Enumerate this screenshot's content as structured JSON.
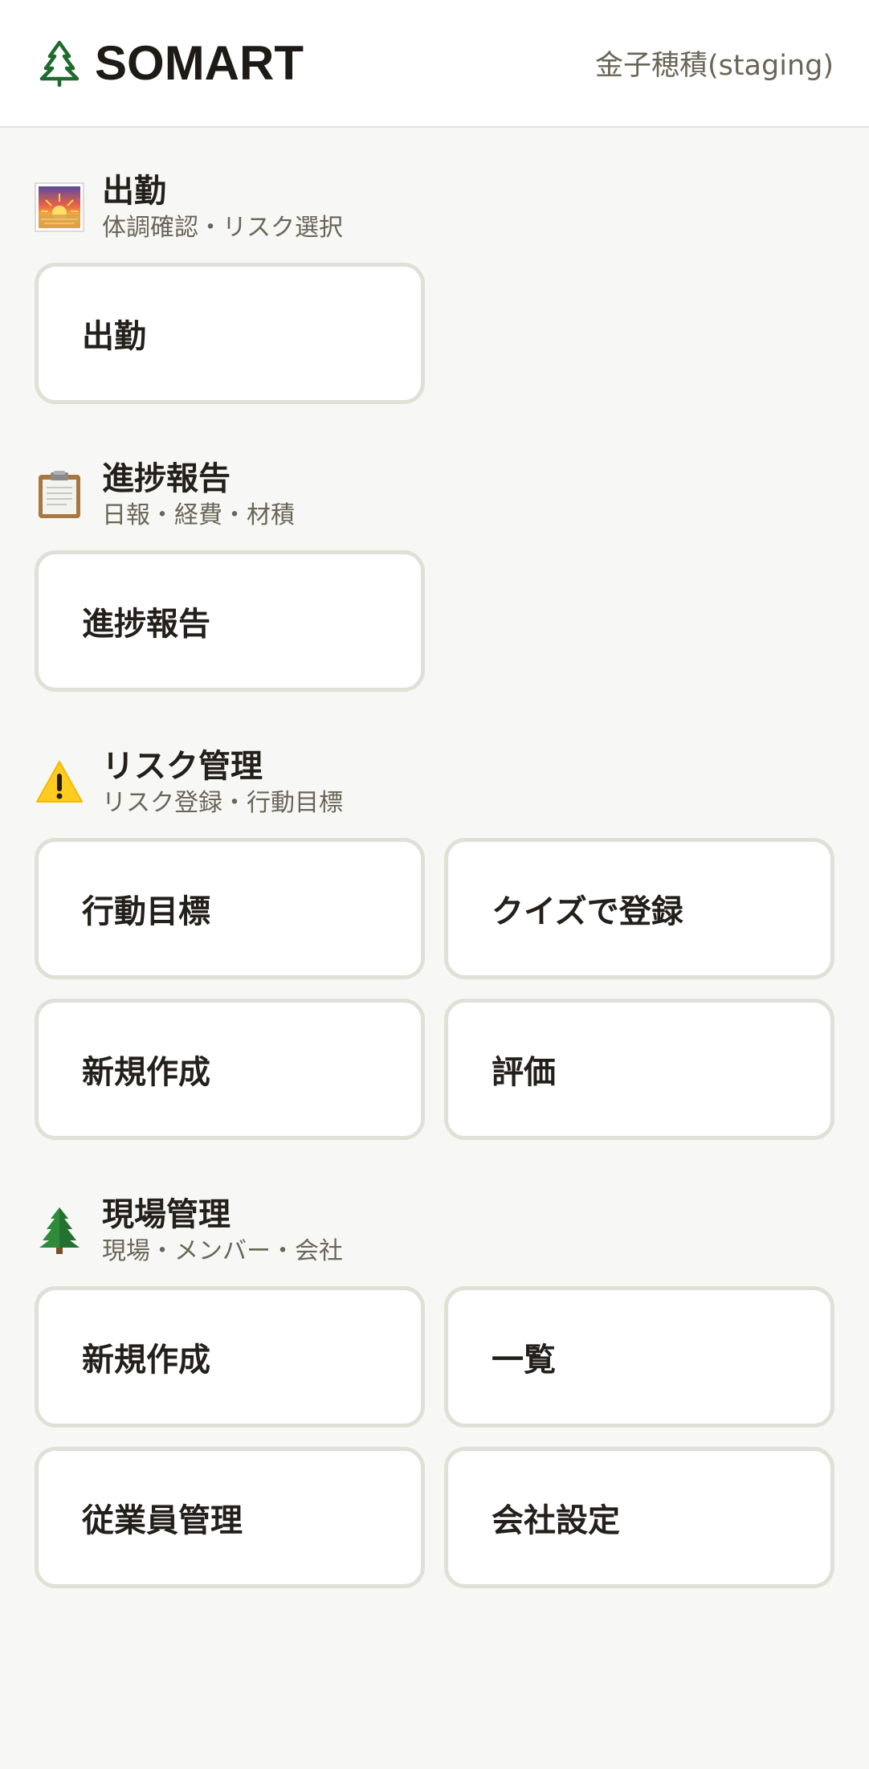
{
  "header": {
    "brand_name": "SOMART",
    "user_name": "金子穂積(staging)",
    "brand_color": "#1f6b2f"
  },
  "sections": [
    {
      "icon": "sunrise-icon",
      "title": "出勤",
      "subtitle": "体調確認・リスク選択",
      "buttons": [
        "出勤"
      ]
    },
    {
      "icon": "clipboard-icon",
      "title": "進捗報告",
      "subtitle": "日報・経費・材積",
      "buttons": [
        "進捗報告"
      ]
    },
    {
      "icon": "warning-icon",
      "title": "リスク管理",
      "subtitle": "リスク登録・行動目標",
      "buttons": [
        "行動目標",
        "クイズで登録",
        "新規作成",
        "評価"
      ]
    },
    {
      "icon": "evergreen-tree-icon",
      "title": "現場管理",
      "subtitle": "現場・メンバー・会社",
      "buttons": [
        "新規作成",
        "一覧",
        "従業員管理",
        "会社設定"
      ]
    }
  ]
}
